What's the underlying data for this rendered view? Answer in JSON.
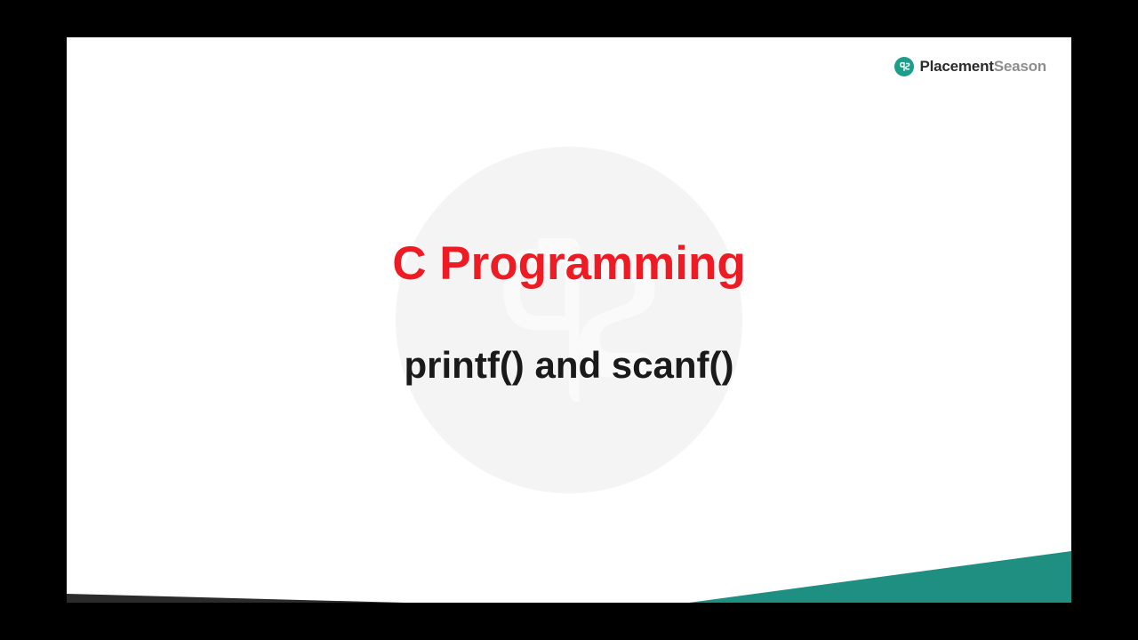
{
  "logo": {
    "brand_part1": "Placement",
    "brand_part2": "Season"
  },
  "slide": {
    "title": "C Programming",
    "subtitle": "printf() and scanf()"
  },
  "colors": {
    "title": "#ed1c24",
    "subtitle": "#1a1a1a",
    "accent": "#1e8f80",
    "logo_badge": "#1d9e8a"
  }
}
